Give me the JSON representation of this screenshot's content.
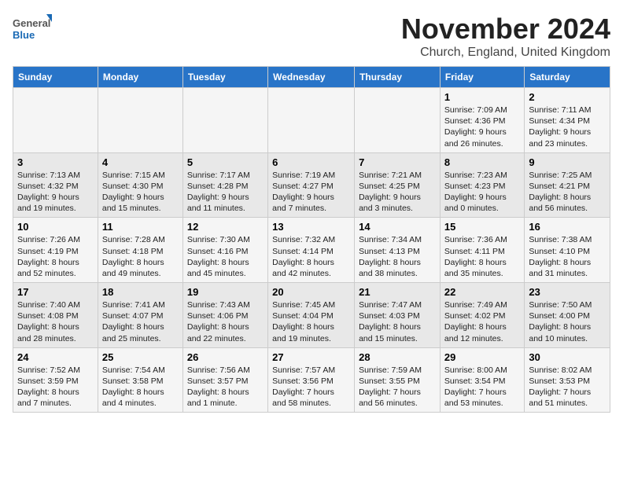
{
  "logo": {
    "general": "General",
    "blue": "Blue"
  },
  "title": "November 2024",
  "location": "Church, England, United Kingdom",
  "weekdays": [
    "Sunday",
    "Monday",
    "Tuesday",
    "Wednesday",
    "Thursday",
    "Friday",
    "Saturday"
  ],
  "weeks": [
    [
      {
        "day": "",
        "info": ""
      },
      {
        "day": "",
        "info": ""
      },
      {
        "day": "",
        "info": ""
      },
      {
        "day": "",
        "info": ""
      },
      {
        "day": "",
        "info": ""
      },
      {
        "day": "1",
        "info": "Sunrise: 7:09 AM\nSunset: 4:36 PM\nDaylight: 9 hours\nand 26 minutes."
      },
      {
        "day": "2",
        "info": "Sunrise: 7:11 AM\nSunset: 4:34 PM\nDaylight: 9 hours\nand 23 minutes."
      }
    ],
    [
      {
        "day": "3",
        "info": "Sunrise: 7:13 AM\nSunset: 4:32 PM\nDaylight: 9 hours\nand 19 minutes."
      },
      {
        "day": "4",
        "info": "Sunrise: 7:15 AM\nSunset: 4:30 PM\nDaylight: 9 hours\nand 15 minutes."
      },
      {
        "day": "5",
        "info": "Sunrise: 7:17 AM\nSunset: 4:28 PM\nDaylight: 9 hours\nand 11 minutes."
      },
      {
        "day": "6",
        "info": "Sunrise: 7:19 AM\nSunset: 4:27 PM\nDaylight: 9 hours\nand 7 minutes."
      },
      {
        "day": "7",
        "info": "Sunrise: 7:21 AM\nSunset: 4:25 PM\nDaylight: 9 hours\nand 3 minutes."
      },
      {
        "day": "8",
        "info": "Sunrise: 7:23 AM\nSunset: 4:23 PM\nDaylight: 9 hours\nand 0 minutes."
      },
      {
        "day": "9",
        "info": "Sunrise: 7:25 AM\nSunset: 4:21 PM\nDaylight: 8 hours\nand 56 minutes."
      }
    ],
    [
      {
        "day": "10",
        "info": "Sunrise: 7:26 AM\nSunset: 4:19 PM\nDaylight: 8 hours\nand 52 minutes."
      },
      {
        "day": "11",
        "info": "Sunrise: 7:28 AM\nSunset: 4:18 PM\nDaylight: 8 hours\nand 49 minutes."
      },
      {
        "day": "12",
        "info": "Sunrise: 7:30 AM\nSunset: 4:16 PM\nDaylight: 8 hours\nand 45 minutes."
      },
      {
        "day": "13",
        "info": "Sunrise: 7:32 AM\nSunset: 4:14 PM\nDaylight: 8 hours\nand 42 minutes."
      },
      {
        "day": "14",
        "info": "Sunrise: 7:34 AM\nSunset: 4:13 PM\nDaylight: 8 hours\nand 38 minutes."
      },
      {
        "day": "15",
        "info": "Sunrise: 7:36 AM\nSunset: 4:11 PM\nDaylight: 8 hours\nand 35 minutes."
      },
      {
        "day": "16",
        "info": "Sunrise: 7:38 AM\nSunset: 4:10 PM\nDaylight: 8 hours\nand 31 minutes."
      }
    ],
    [
      {
        "day": "17",
        "info": "Sunrise: 7:40 AM\nSunset: 4:08 PM\nDaylight: 8 hours\nand 28 minutes."
      },
      {
        "day": "18",
        "info": "Sunrise: 7:41 AM\nSunset: 4:07 PM\nDaylight: 8 hours\nand 25 minutes."
      },
      {
        "day": "19",
        "info": "Sunrise: 7:43 AM\nSunset: 4:06 PM\nDaylight: 8 hours\nand 22 minutes."
      },
      {
        "day": "20",
        "info": "Sunrise: 7:45 AM\nSunset: 4:04 PM\nDaylight: 8 hours\nand 19 minutes."
      },
      {
        "day": "21",
        "info": "Sunrise: 7:47 AM\nSunset: 4:03 PM\nDaylight: 8 hours\nand 15 minutes."
      },
      {
        "day": "22",
        "info": "Sunrise: 7:49 AM\nSunset: 4:02 PM\nDaylight: 8 hours\nand 12 minutes."
      },
      {
        "day": "23",
        "info": "Sunrise: 7:50 AM\nSunset: 4:00 PM\nDaylight: 8 hours\nand 10 minutes."
      }
    ],
    [
      {
        "day": "24",
        "info": "Sunrise: 7:52 AM\nSunset: 3:59 PM\nDaylight: 8 hours\nand 7 minutes."
      },
      {
        "day": "25",
        "info": "Sunrise: 7:54 AM\nSunset: 3:58 PM\nDaylight: 8 hours\nand 4 minutes."
      },
      {
        "day": "26",
        "info": "Sunrise: 7:56 AM\nSunset: 3:57 PM\nDaylight: 8 hours\nand 1 minute."
      },
      {
        "day": "27",
        "info": "Sunrise: 7:57 AM\nSunset: 3:56 PM\nDaylight: 7 hours\nand 58 minutes."
      },
      {
        "day": "28",
        "info": "Sunrise: 7:59 AM\nSunset: 3:55 PM\nDaylight: 7 hours\nand 56 minutes."
      },
      {
        "day": "29",
        "info": "Sunrise: 8:00 AM\nSunset: 3:54 PM\nDaylight: 7 hours\nand 53 minutes."
      },
      {
        "day": "30",
        "info": "Sunrise: 8:02 AM\nSunset: 3:53 PM\nDaylight: 7 hours\nand 51 minutes."
      }
    ]
  ]
}
